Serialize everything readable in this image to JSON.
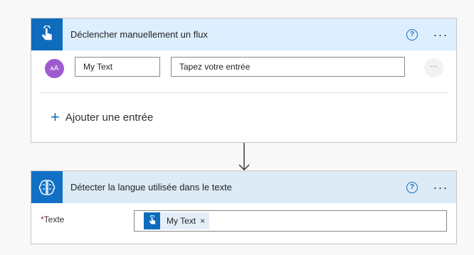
{
  "trigger_card": {
    "title": "Déclencher manuellement un flux",
    "help_symbol": "?",
    "more_symbol": "···",
    "icon": "touch-hand-icon",
    "accent_color": "#0f6cbd",
    "input_row": {
      "avatar_text": "ᴀA",
      "name_value": "My Text",
      "value_placeholder": "Tapez votre entrée",
      "more_symbol": "···"
    },
    "add_input_symbol": "+",
    "add_input_label": "Ajouter une entrée"
  },
  "action_card": {
    "title": "Détecter la langue utilisée dans le texte",
    "help_symbol": "?",
    "more_symbol": "···",
    "icon": "brain-icon",
    "field": {
      "required_mark": "*",
      "label": "Texte",
      "token": {
        "label": "My Text",
        "close_symbol": "×",
        "icon": "touch-hand-icon"
      }
    }
  }
}
